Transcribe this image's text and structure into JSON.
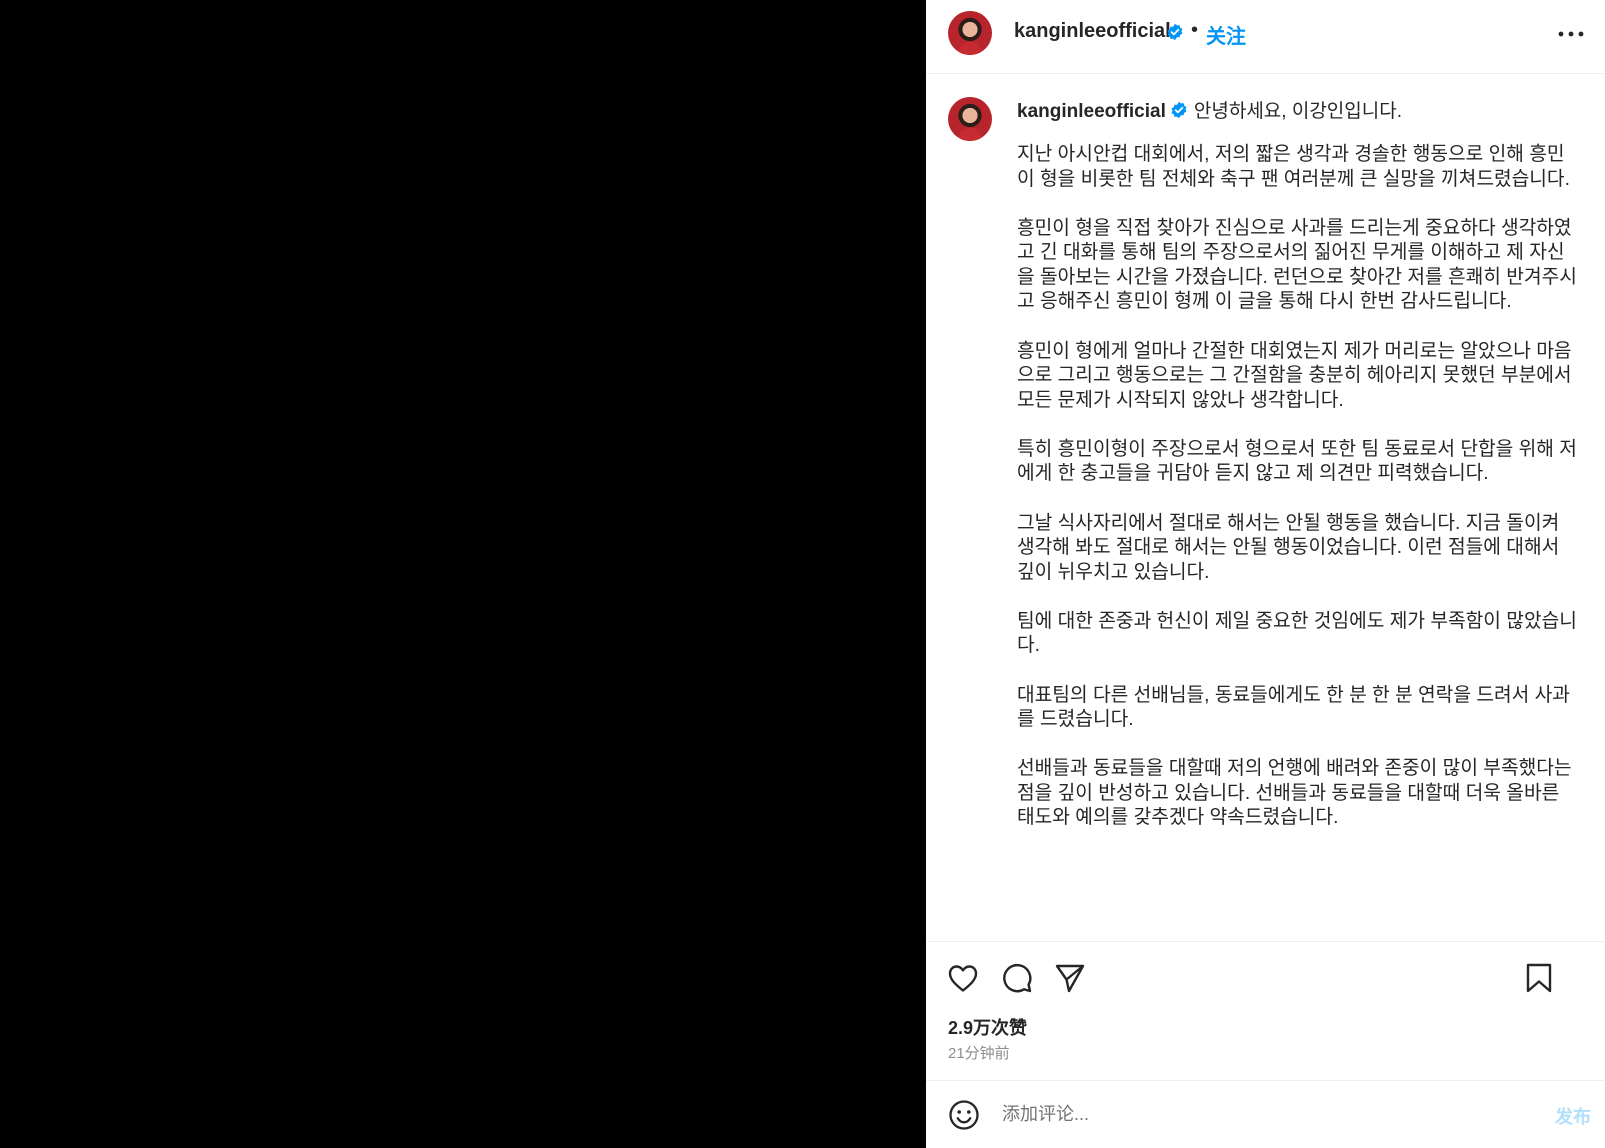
{
  "header": {
    "username": "kanginleeofficial",
    "separator": "•",
    "follow_label": "关注",
    "more_icon": "more-horizontal-icon"
  },
  "caption": {
    "username": "kanginleeofficial",
    "greeting": "안녕하세요, 이강인입니다.",
    "paragraphs": [
      "지난 아시안컵 대회에서, 저의 짧은 생각과 경솔한 행동으로 인해 흥민이 형을 비롯한 팀 전체와 축구 팬 여러분께 큰 실망을 끼쳐드렸습니다.",
      "흥민이 형을 직접 찾아가 진심으로 사과를 드리는게 중요하다 생각하였고 긴 대화를 통해 팀의 주장으로서의 짊어진 무게를 이해하고 제 자신을 돌아보는 시간을 가졌습니다. 런던으로 찾아간 저를 흔쾌히 반겨주시고 응해주신 흥민이 형께 이 글을 통해 다시 한번 감사드립니다.",
      "흥민이 형에게 얼마나 간절한 대회였는지 제가 머리로는 알았으나 마음으로 그리고 행동으로는 그 간절함을 충분히 헤아리지 못했던 부분에서 모든 문제가 시작되지 않았나 생각합니다.",
      "특히 흥민이형이 주장으로서 형으로서 또한 팀 동료로서 단합을 위해 저에게 한 충고들을 귀담아 듣지 않고 제 의견만 피력했습니다.",
      "그날 식사자리에서 절대로 해서는 안될 행동을 했습니다. 지금 돌이켜 생각해 봐도 절대로 해서는 안될 행동이었습니다. 이런 점들에 대해서 깊이 뉘우치고 있습니다.",
      "팀에 대한 존중과 헌신이 제일 중요한 것임에도 제가 부족함이 많았습니다.",
      "대표팀의 다른 선배님들, 동료들에게도 한 분 한 분 연락을 드려서 사과를 드렸습니다.",
      "선배들과 동료들을 대할때 저의 언행에 배려와 존중이 많이 부족했다는 점을 깊이 반성하고 있습니다. 선배들과 동료들을 대할때 더욱 올바른 태도와 예의를 갖추겠다 약속드렸습니다."
    ]
  },
  "actions": {
    "likes": "2.9万次赞",
    "time": "21分钟前",
    "icons": [
      "heart-icon",
      "comment-icon",
      "share-icon",
      "bookmark-icon"
    ]
  },
  "comment_box": {
    "placeholder": "添加评论...",
    "value": "",
    "post_label": "发布"
  },
  "colors": {
    "accent": "#0095f6",
    "verified": "#0095f6",
    "post_disabled": "#b2dffc"
  }
}
